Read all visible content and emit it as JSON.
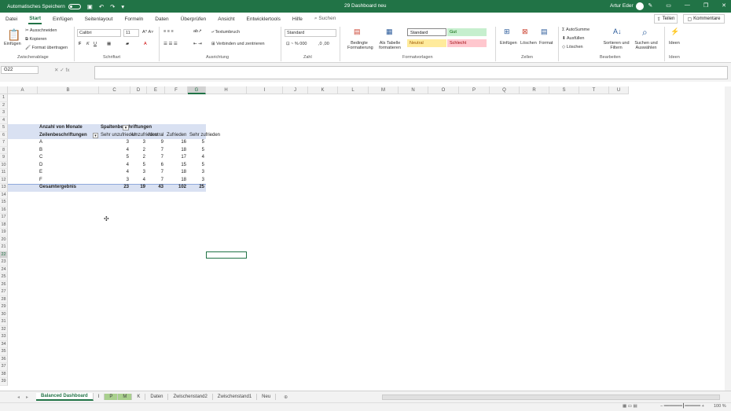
{
  "titlebar": {
    "autosave_label": "Automatisches Speichern",
    "title": "29 Dashboard neu",
    "user": "Artur Eder"
  },
  "menu": {
    "tabs": [
      "Datei",
      "Start",
      "Einfügen",
      "Seitenlayout",
      "Formeln",
      "Daten",
      "Überprüfen",
      "Ansicht",
      "Entwicklertools",
      "Hilfe"
    ],
    "search": "Suchen",
    "share": "Teilen",
    "comments": "Kommentare"
  },
  "ribbon": {
    "clipboard": {
      "paste": "Einfügen",
      "cut": "Ausschneiden",
      "copy": "Kopieren",
      "format_painter": "Format übertragen",
      "label": "Zwischenablage"
    },
    "font": {
      "name": "Calibri",
      "size": "11",
      "label": "Schriftart"
    },
    "alignment": {
      "wrap": "Textumbruch",
      "merge": "Verbinden und zentrieren",
      "label": "Ausrichtung"
    },
    "number": {
      "format": "Standard",
      "label": "Zahl"
    },
    "styles": {
      "conditional": "Bedingte Formatierung",
      "as_table": "Als Tabelle formatieren",
      "standard": "Standard",
      "gut": "Gut",
      "neutral": "Neutral",
      "schlecht": "Schlecht",
      "label": "Formatvorlagen"
    },
    "cells": {
      "insert": "Einfügen",
      "delete": "Löschen",
      "format": "Format",
      "label": "Zellen"
    },
    "editing": {
      "autosum": "AutoSumme",
      "fill": "Ausfüllen",
      "clear": "Löschen",
      "sort": "Sortieren und Filtern",
      "find": "Suchen und Auswählen",
      "label": "Bearbeiten"
    },
    "ideas": {
      "btn": "Ideen",
      "label": "Ideen"
    }
  },
  "formula": {
    "namebox": "G22",
    "value": ""
  },
  "columns": [
    "A",
    "B",
    "C",
    "D",
    "E",
    "F",
    "G",
    "H",
    "I",
    "J",
    "K",
    "L",
    "M",
    "N",
    "O",
    "P",
    "Q",
    "R",
    "S",
    "T",
    "U"
  ],
  "rows": [
    "1",
    "2",
    "3",
    "4",
    "5",
    "6",
    "7",
    "8",
    "9",
    "10",
    "11",
    "12",
    "13",
    "14",
    "15",
    "16",
    "17",
    "18",
    "19",
    "20",
    "21",
    "22",
    "23",
    "24",
    "25",
    "26",
    "27",
    "28",
    "29",
    "30",
    "31",
    "32",
    "33",
    "34",
    "35",
    "36",
    "37",
    "38",
    "39"
  ],
  "pivot": {
    "header_value": "Anzahl von Monate",
    "header_columns": "Spaltenbeschriftungen",
    "row_labels": "Zeilenbeschriftungen",
    "col_labels": [
      "Sehr unzufrieden",
      "Unzufrieden",
      "Neutral",
      "Zufrieden",
      "Sehr zufrieden"
    ],
    "rows": [
      {
        "label": "A",
        "values": [
          "3",
          "3",
          "9",
          "16",
          "5"
        ]
      },
      {
        "label": "B",
        "values": [
          "4",
          "2",
          "7",
          "18",
          "5"
        ]
      },
      {
        "label": "C",
        "values": [
          "5",
          "2",
          "7",
          "17",
          "4"
        ]
      },
      {
        "label": "D",
        "values": [
          "4",
          "5",
          "6",
          "15",
          "5"
        ]
      },
      {
        "label": "E",
        "values": [
          "4",
          "3",
          "7",
          "18",
          "3"
        ]
      },
      {
        "label": "F",
        "values": [
          "3",
          "4",
          "7",
          "18",
          "3"
        ]
      }
    ],
    "total": {
      "label": "Gesamtergebnis",
      "values": [
        "23",
        "19",
        "43",
        "102",
        "25"
      ]
    }
  },
  "sheets": [
    "Balanced Dashboard",
    "I",
    "P",
    "M",
    "K",
    "Daten",
    "Zwischenstand2",
    "Zwischenstand1",
    "Neu"
  ],
  "status": {
    "zoom": "100 %"
  }
}
